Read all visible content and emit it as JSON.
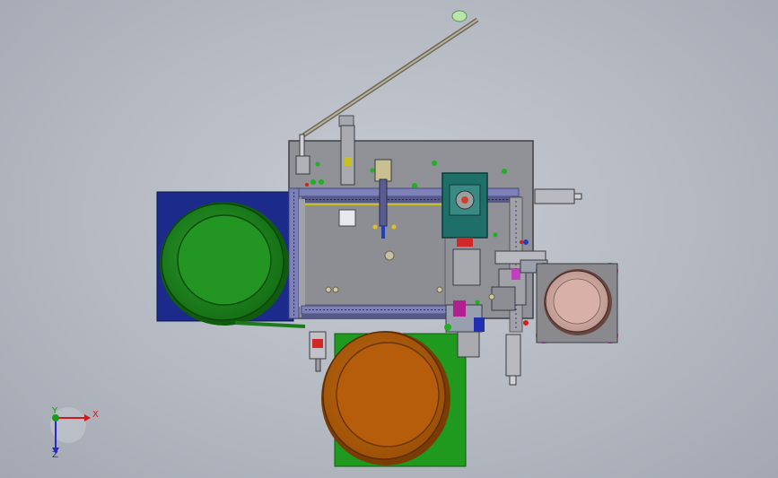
{
  "viewport": {
    "background": "#b4b9c2"
  },
  "scene": {
    "base_plate": {
      "color": "#8f9196"
    },
    "feeder_bowl_left": {
      "outer_color": "#1a8c1a",
      "inner_color": "#2a9a2a",
      "platform_color": "#1c2a8c"
    },
    "feeder_bowl_bottom": {
      "outer_color": "#c06a10",
      "inner_color": "#b85f0a",
      "platform_color": "#1f9a1f"
    },
    "output_tray_right": {
      "tray_color": "#d8b0a8",
      "frame_color": "#8a8a8e",
      "foot_color": "#b0359c"
    },
    "rotary_module": {
      "color": "#1e6f6a",
      "hub_color": "#d04030"
    },
    "indicator_colors": [
      "#20b020",
      "#d02020",
      "#c040c0",
      "#2040c0",
      "#e0c020"
    ]
  },
  "triad": {
    "x_label": "X",
    "y_label": "Y",
    "z_label": "Z",
    "x_color": "#d01818",
    "y_color": "#1a9a1a",
    "z_color": "#2828c8"
  }
}
